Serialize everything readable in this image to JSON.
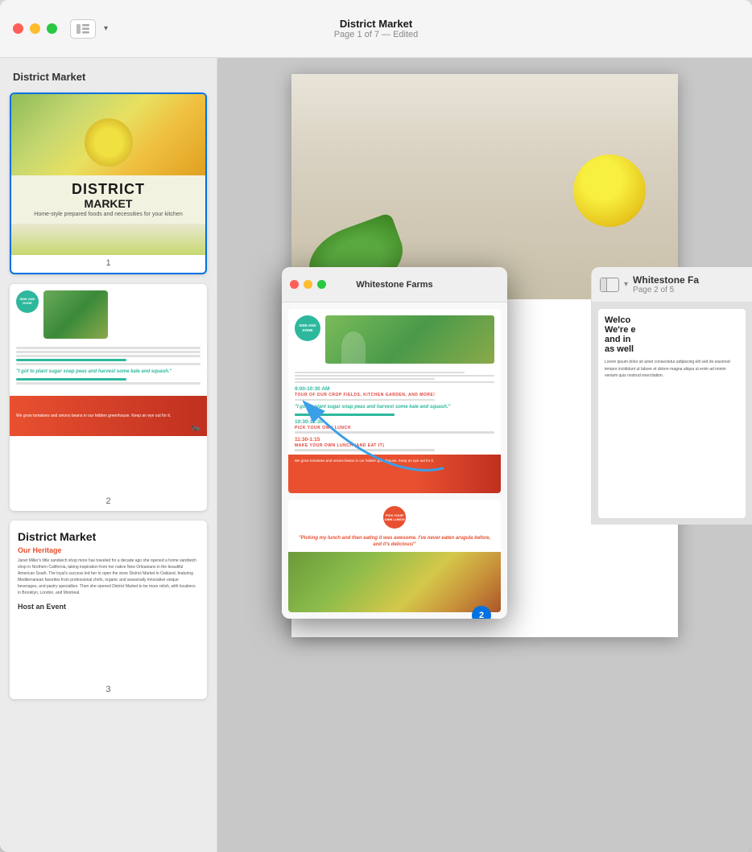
{
  "window": {
    "title": "District Market",
    "subtitle": "Page 1 of 7 — Edited",
    "sidebar_label": "District Market"
  },
  "popup_window": {
    "title": "Whitestone Farms"
  },
  "right_window": {
    "title": "Whitestone Fa",
    "subtitle": "Page 2 of 5"
  },
  "sidebar": {
    "pages": [
      {
        "number": "1",
        "label": "1"
      },
      {
        "number": "2",
        "label": "2"
      },
      {
        "number": "3",
        "label": "3"
      }
    ]
  },
  "thumb1": {
    "district": "DISTRICT",
    "market": "MARKET",
    "tagline": "Home-style prepared foods and necessities for your kitchen"
  },
  "thumb2": {
    "circle_text": "SIDE AND DONE",
    "quote": "\"I got to plant sugar snap peas and harvest some kale and squash.\"",
    "red_text": "We grow tomatoes and onions beans in our hidden greenhouse. Keep an eye out for it."
  },
  "thumb3": {
    "title": "District Market",
    "subtitle": "Our Heritage",
    "body_text": "Janet Miller's little sandwich shop more has traveled for a decade ago she opened a home sandwich shop in Northern California, taking inspiration from her native New Orleanians in the beautiful American South. The loyal's success led her to open the store District Market in Oakland, featuring Mediterranean favorites from professional chefs, organic and seasonally innovative unique beverages, and pastry specialties. Then she opened District Market to be more relish, with locations in Brooklyn, London, and Montreal.",
    "event_label": "Host an Event"
  },
  "popup": {
    "circle_text": "SIDE AND DONE",
    "time1": "9:00-10:30 AM",
    "event1": "TOUR OF OUR CROP FIELDS, KITCHEN GARDEN, AND MORE!",
    "time2": "10:30-11:30",
    "event2": "PICK YOUR OWN LUNCH",
    "time3": "11:30-1:15",
    "event3": "MAKE YOUR OWN LUNCH (AND EAT IT)",
    "quote": "\"I got to plant sugar snap peas and harvest some kale and squash.\"",
    "red_text": "We grow tomatoes and onions beans in our hidden greenhouse. Keep an eye out for it.",
    "page_badge": "2"
  },
  "colors": {
    "teal": "#2db89d",
    "red_accent": "#e85030",
    "blue_link": "#0071e3",
    "dark_text": "#1a1a1a"
  }
}
